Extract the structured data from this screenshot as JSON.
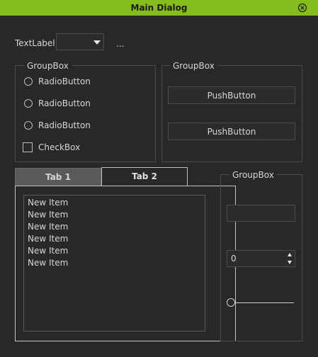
{
  "window": {
    "title": "Main Dialog",
    "close_icon": "close-circle-icon",
    "accent_color": "#84bd1d"
  },
  "top_row": {
    "label": "TextLabel",
    "combo_value": "",
    "ellipsis": "..."
  },
  "group_left": {
    "title": "GroupBox",
    "radios": [
      {
        "label": "RadioButton",
        "checked": false
      },
      {
        "label": "RadioButton",
        "checked": false
      },
      {
        "label": "RadioButton",
        "checked": false
      }
    ],
    "checkbox": {
      "label": "CheckBox",
      "checked": false
    }
  },
  "group_right": {
    "title": "GroupBox",
    "buttons": [
      {
        "label": "PushButton"
      },
      {
        "label": "PushButton"
      }
    ]
  },
  "tabs": [
    {
      "label": "Tab 1",
      "active": true
    },
    {
      "label": "Tab 2",
      "active": false
    }
  ],
  "list": {
    "items": [
      "New Item",
      "New Item",
      "New Item",
      "New Item",
      "New Item",
      "New Item"
    ]
  },
  "group_bottom": {
    "title": "GroupBox",
    "line_edit_value": "",
    "spin_value": "0",
    "slider_value": 0
  }
}
